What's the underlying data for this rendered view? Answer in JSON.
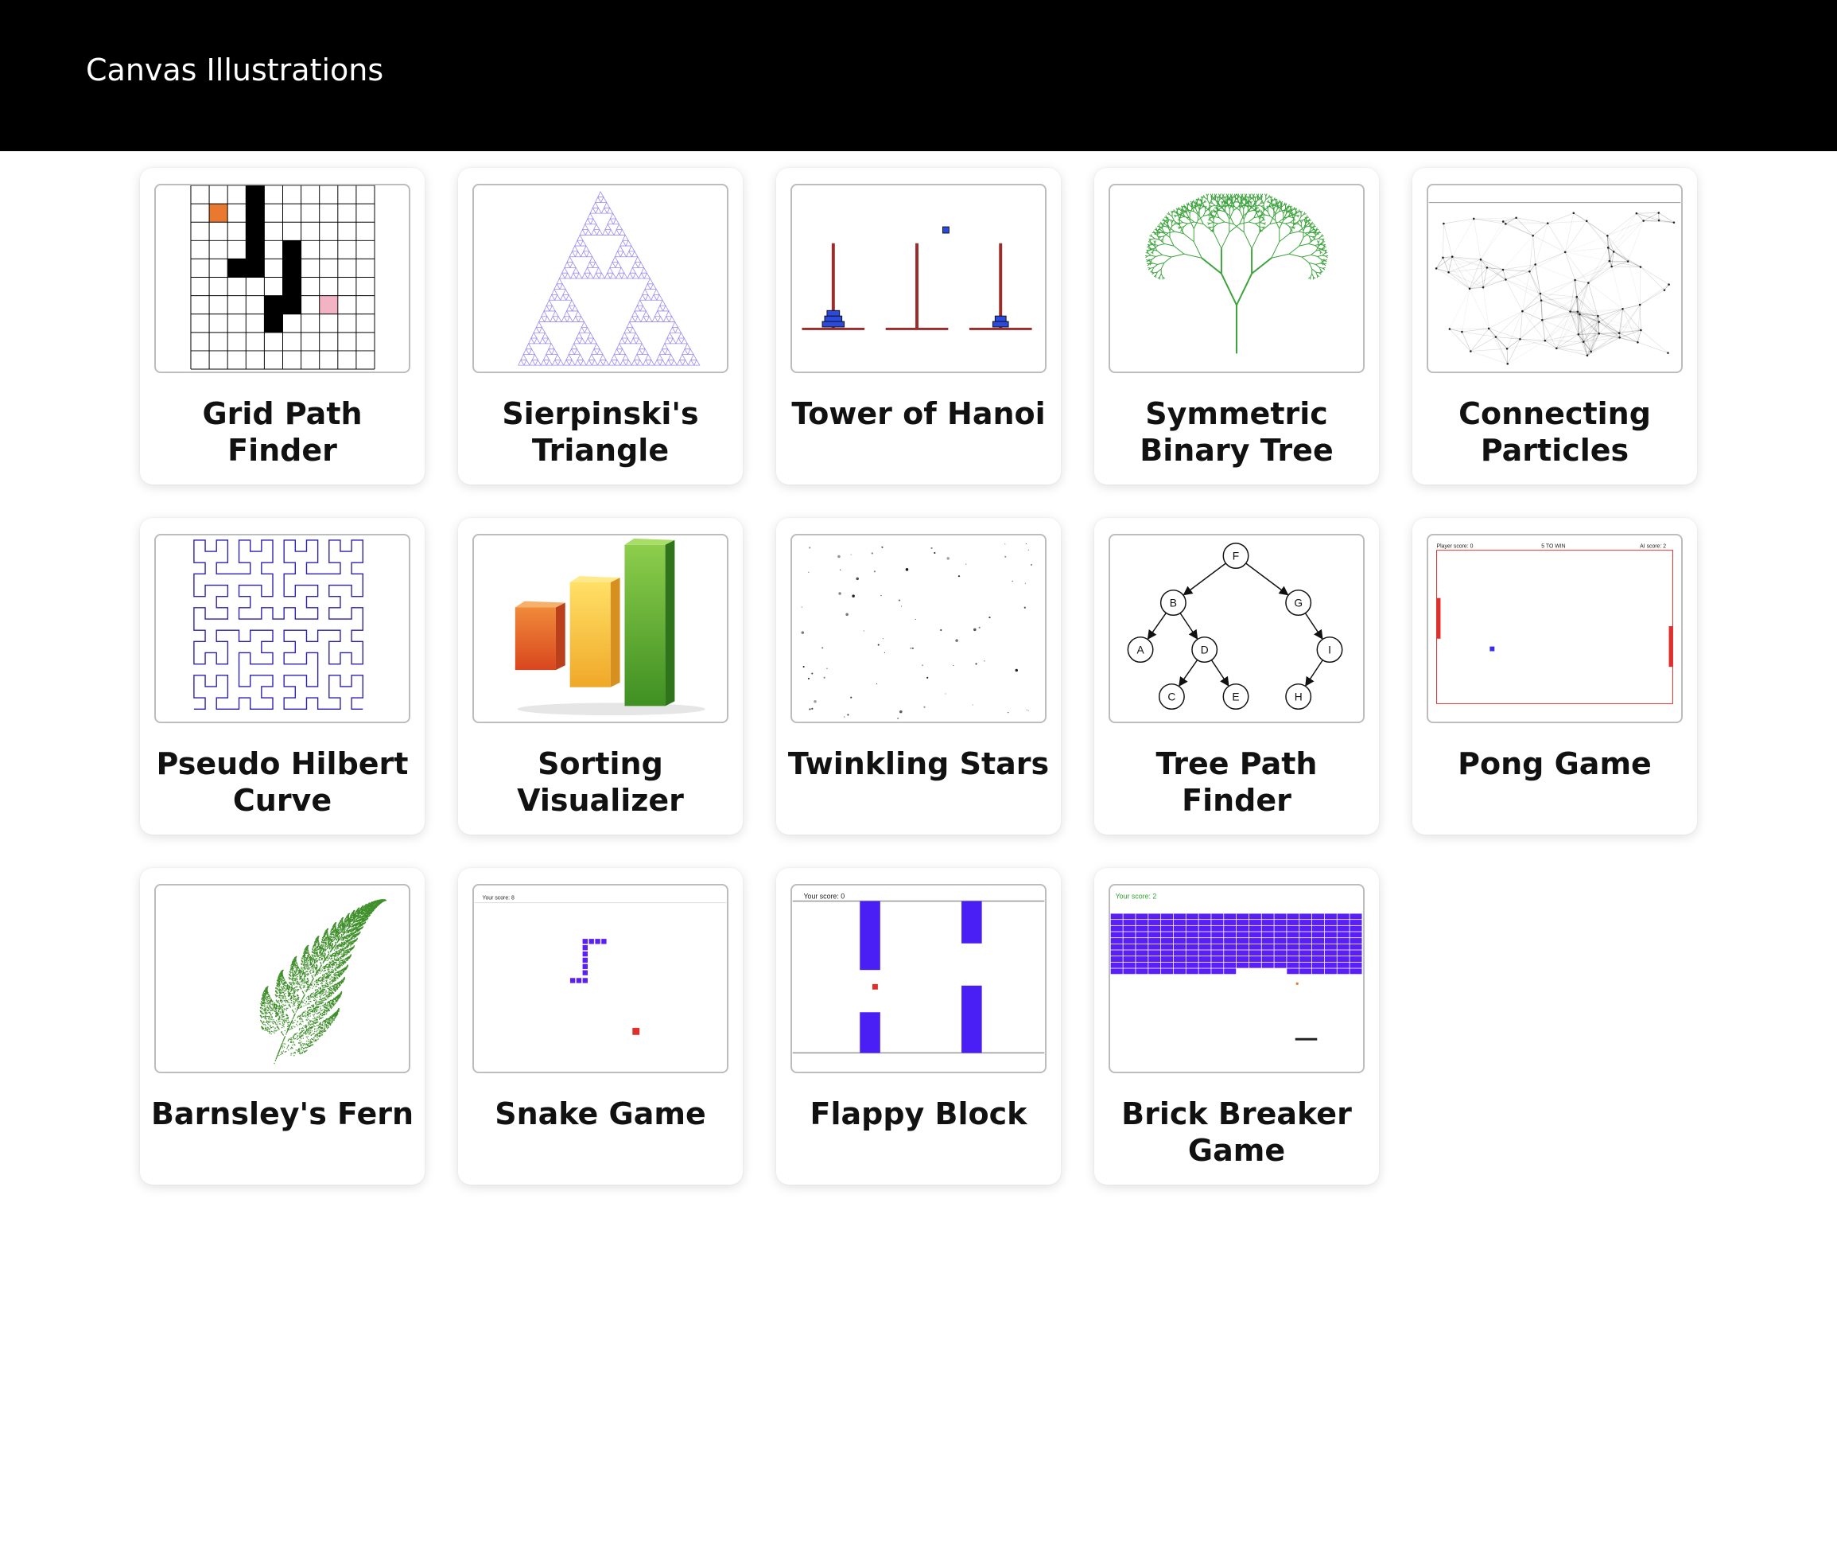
{
  "header": {
    "title": "Canvas Illustrations"
  },
  "cards": [
    {
      "label": "Grid Path Finder",
      "icon": "grid-path-finder-thumbnail"
    },
    {
      "label": "Sierpinski's Triangle",
      "icon": "sierpinski-triangle-thumbnail"
    },
    {
      "label": "Tower of Hanoi",
      "icon": "tower-of-hanoi-thumbnail"
    },
    {
      "label": "Symmetric Binary Tree",
      "icon": "binary-tree-thumbnail"
    },
    {
      "label": "Connecting Particles",
      "icon": "connecting-particles-thumbnail"
    },
    {
      "label": "Pseudo Hilbert Curve",
      "icon": "hilbert-curve-thumbnail"
    },
    {
      "label": "Sorting Visualizer",
      "icon": "bar-chart-thumbnail"
    },
    {
      "label": "Twinkling Stars",
      "icon": "stars-thumbnail"
    },
    {
      "label": "Tree Path Finder",
      "icon": "tree-graph-thumbnail"
    },
    {
      "label": "Pong Game",
      "icon": "pong-thumbnail"
    },
    {
      "label": "Barnsley's Fern",
      "icon": "fern-thumbnail"
    },
    {
      "label": "Snake Game",
      "icon": "snake-thumbnail"
    },
    {
      "label": "Flappy Block",
      "icon": "flappy-block-thumbnail"
    },
    {
      "label": "Brick Breaker Game",
      "icon": "brick-breaker-thumbnail"
    }
  ],
  "thumbs": {
    "tree_nodes": [
      "F",
      "B",
      "G",
      "A",
      "D",
      "I",
      "C",
      "E",
      "H"
    ],
    "pong": {
      "player": "Player score: 0",
      "target": "5 TO WIN",
      "ai": "AI score: 2"
    },
    "snake_score": "Your score: 8",
    "flappy_score": "Your score: 0",
    "brick_score": "Your score: 2"
  },
  "colors": {
    "header_bg": "#000000",
    "grid_start": "#e8792e",
    "grid_goal": "#f2b4c4",
    "sierpinski": "#9b8cf0",
    "hanoi_pole": "#9b2c2c",
    "hanoi_disk": "#2a4adf",
    "tree_green": "#3aa33a",
    "hilbert": "#2a1fb0",
    "game_purple": "#5a1ff5",
    "game_red": "#e0302c",
    "brick_score": "#2fa52f",
    "fern": "#3f8f2b"
  }
}
